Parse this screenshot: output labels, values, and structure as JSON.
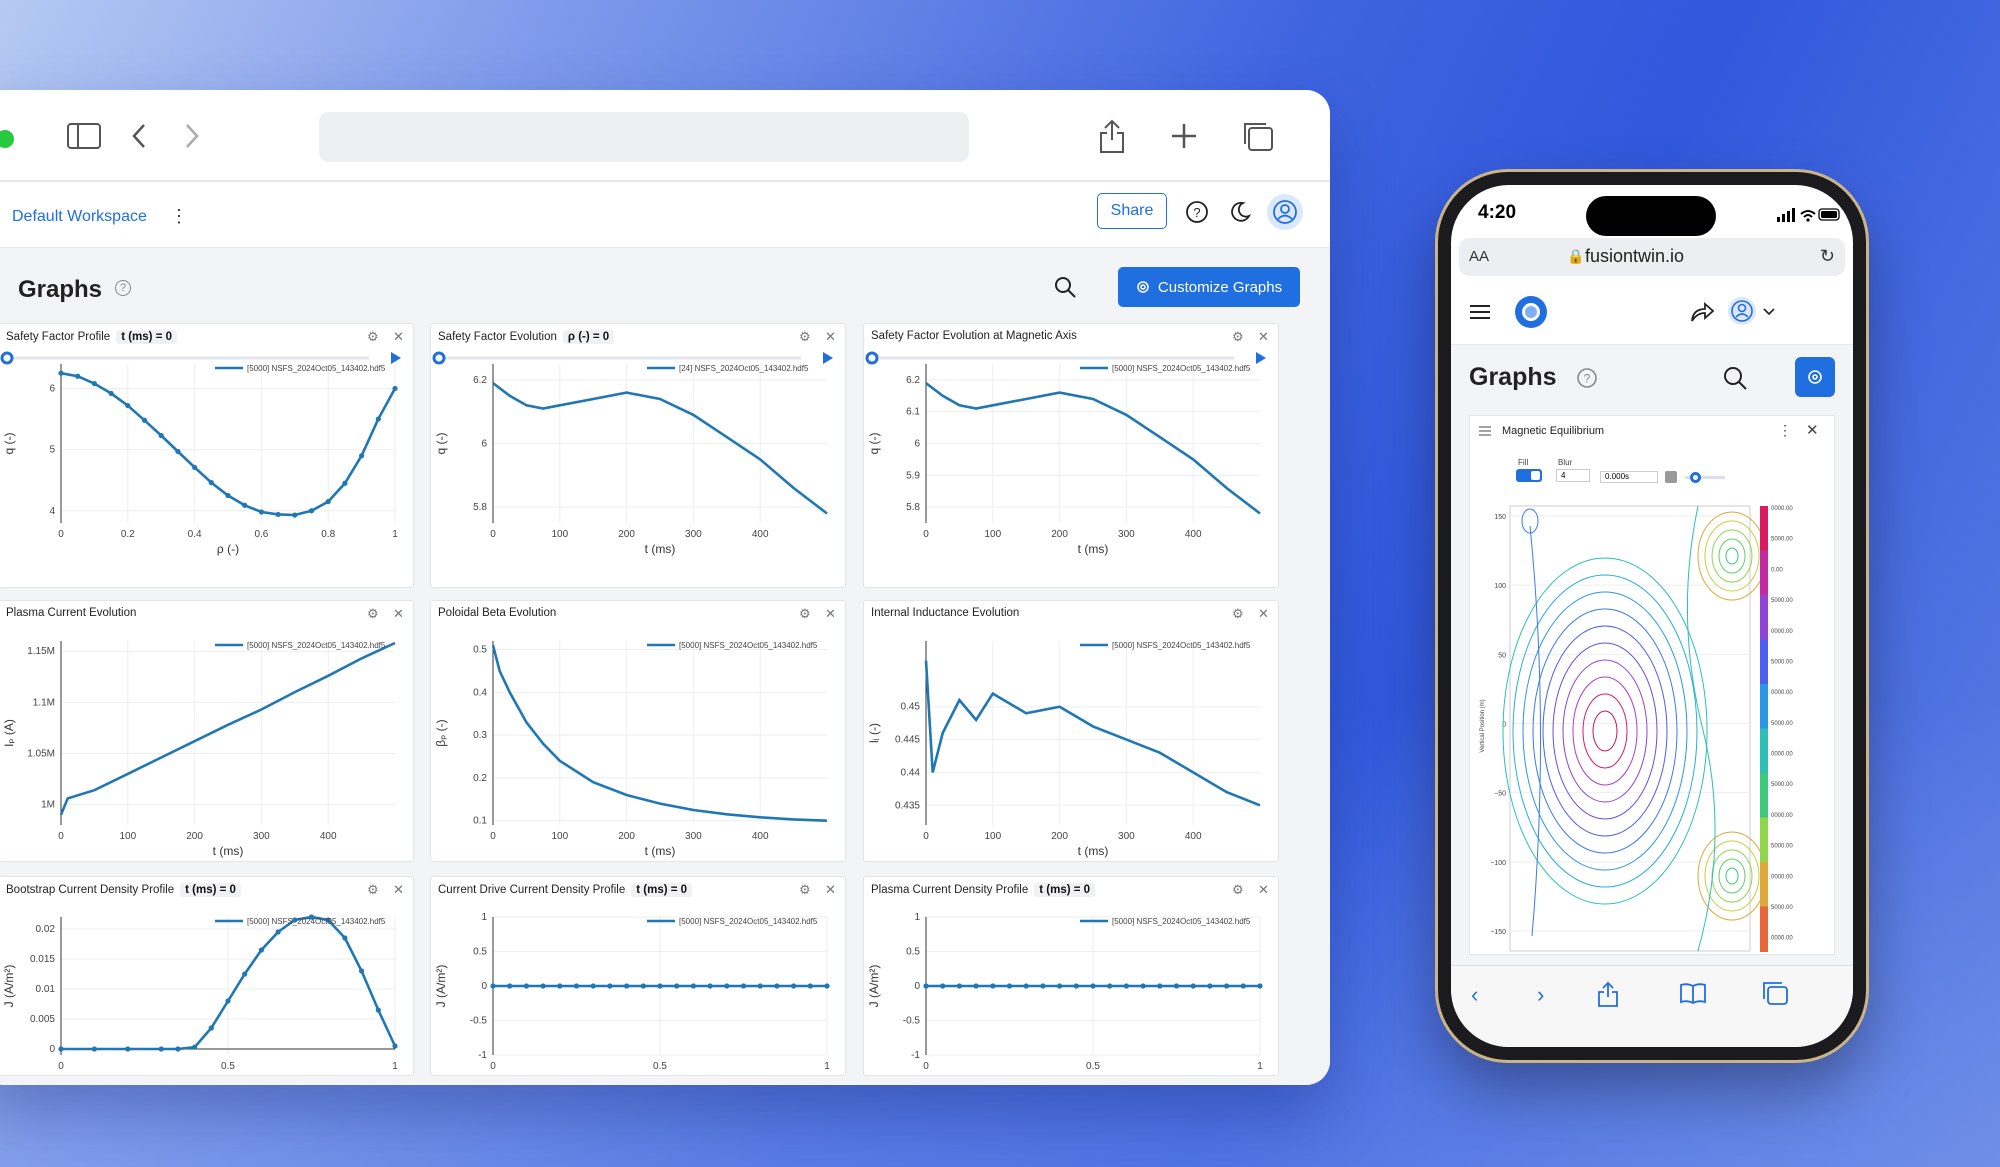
{
  "browser": {
    "dot_color": "#27c93f"
  },
  "app": {
    "workspace": "Default Workspace",
    "share_label": "Share",
    "page_title": "Graphs",
    "customize_label": "Customize Graphs"
  },
  "colors": {
    "accent": "#1f6fe0",
    "series": "#1f77b4"
  },
  "panels": [
    {
      "title": "Safety Factor Profile",
      "badge": "t (ms) = 0"
    },
    {
      "title": "Safety Factor Evolution",
      "badge": "ρ (-) = 0"
    },
    {
      "title": "Safety Factor Evolution at Magnetic Axis",
      "badge": ""
    },
    {
      "title": "Plasma Current Evolution",
      "badge": ""
    },
    {
      "title": "Poloidal Beta Evolution",
      "badge": ""
    },
    {
      "title": "Internal Inductance Evolution",
      "badge": ""
    },
    {
      "title": "Bootstrap Current Density Profile",
      "badge": "t (ms) = 0"
    },
    {
      "title": "Current Drive Current Density Profile",
      "badge": "t (ms) = 0"
    },
    {
      "title": "Plasma Current Density Profile",
      "badge": "t (ms) = 0"
    }
  ],
  "chart_data": [
    {
      "type": "line",
      "series": [
        {
          "name": "[5000] NSFS_2024Oct05_143402.hdf5",
          "x": [
            0,
            0.05,
            0.1,
            0.15,
            0.2,
            0.25,
            0.3,
            0.35,
            0.4,
            0.45,
            0.5,
            0.55,
            0.6,
            0.65,
            0.7,
            0.75,
            0.8,
            0.85,
            0.9,
            0.95,
            1.0
          ],
          "y": [
            6.25,
            6.2,
            6.08,
            5.92,
            5.72,
            5.48,
            5.23,
            4.97,
            4.71,
            4.46,
            4.25,
            4.09,
            3.98,
            3.94,
            3.93,
            4.0,
            4.15,
            4.45,
            4.9,
            5.5,
            6.0
          ]
        }
      ],
      "xlabel": "ρ (-)",
      "ylabel": "q (-)",
      "xlim": [
        0,
        1
      ],
      "ylim": [
        3.8,
        6.4
      ],
      "xticks": [
        "0",
        "0.2",
        "0.4",
        "0.6",
        "0.8",
        "1"
      ],
      "yticks": [
        "4",
        "5",
        "6"
      ]
    },
    {
      "type": "line",
      "series": [
        {
          "name": "[24] NSFS_2024Oct05_143402.hdf5",
          "x": [
            0,
            25,
            50,
            75,
            100,
            150,
            200,
            250,
            300,
            350,
            400,
            450,
            500
          ],
          "y": [
            6.19,
            6.15,
            6.12,
            6.11,
            6.12,
            6.14,
            6.16,
            6.14,
            6.09,
            6.02,
            5.95,
            5.86,
            5.78
          ]
        }
      ],
      "xlabel": "t (ms)",
      "ylabel": "q (-)",
      "xlim": [
        0,
        500
      ],
      "ylim": [
        5.75,
        6.25
      ],
      "xticks": [
        "0",
        "100",
        "200",
        "300",
        "400"
      ],
      "yticks": [
        "5.8",
        "6",
        "6.2"
      ]
    },
    {
      "type": "line",
      "series": [
        {
          "name": "[5000] NSFS_2024Oct05_143402.hdf5",
          "x": [
            0,
            25,
            50,
            75,
            100,
            150,
            200,
            250,
            300,
            350,
            400,
            450,
            500
          ],
          "y": [
            6.19,
            6.15,
            6.12,
            6.11,
            6.12,
            6.14,
            6.16,
            6.14,
            6.09,
            6.02,
            5.95,
            5.86,
            5.78
          ]
        }
      ],
      "xlabel": "t (ms)",
      "ylabel": "q (-)",
      "xlim": [
        0,
        500
      ],
      "ylim": [
        5.75,
        6.25
      ],
      "xticks": [
        "0",
        "100",
        "200",
        "300",
        "400"
      ],
      "yticks": [
        "5.8",
        "5.9",
        "6",
        "6.1",
        "6.2"
      ]
    },
    {
      "type": "line",
      "series": [
        {
          "name": "[5000] NSFS_2024Oct05_143402.hdf5",
          "x": [
            0,
            10,
            50,
            100,
            150,
            200,
            250,
            300,
            350,
            400,
            450,
            500
          ],
          "y": [
            990000,
            1006000,
            1014000,
            1030000,
            1046000,
            1062000,
            1078000,
            1093000,
            1110000,
            1126000,
            1143000,
            1158000
          ]
        }
      ],
      "xlabel": "t (ms)",
      "ylabel": "Iₚ (A)",
      "xlim": [
        0,
        500
      ],
      "ylim": [
        980000,
        1160000
      ],
      "xticks": [
        "0",
        "100",
        "200",
        "300",
        "400"
      ],
      "yticks": [
        "1M",
        "1.05M",
        "1.1M",
        "1.15M"
      ]
    },
    {
      "type": "line",
      "series": [
        {
          "name": "[5000] NSFS_2024Oct05_143402.hdf5",
          "x": [
            0,
            10,
            25,
            50,
            75,
            100,
            150,
            200,
            250,
            300,
            350,
            400,
            450,
            500
          ],
          "y": [
            0.51,
            0.45,
            0.4,
            0.33,
            0.28,
            0.24,
            0.19,
            0.16,
            0.14,
            0.125,
            0.115,
            0.108,
            0.103,
            0.1
          ]
        }
      ],
      "xlabel": "t (ms)",
      "ylabel": "βₚ (-)",
      "xlim": [
        0,
        500
      ],
      "ylim": [
        0.09,
        0.52
      ],
      "xticks": [
        "0",
        "100",
        "200",
        "300",
        "400"
      ],
      "yticks": [
        "0.1",
        "0.2",
        "0.3",
        "0.4",
        "0.5"
      ]
    },
    {
      "type": "line",
      "series": [
        {
          "name": "[5000] NSFS_2024Oct05_143402.hdf5",
          "x": [
            0,
            10,
            25,
            50,
            75,
            100,
            150,
            200,
            250,
            300,
            350,
            400,
            450,
            500
          ],
          "y": [
            0.457,
            0.44,
            0.446,
            0.451,
            0.448,
            0.452,
            0.449,
            0.45,
            0.447,
            0.445,
            0.443,
            0.44,
            0.437,
            0.435
          ]
        }
      ],
      "xlabel": "t (ms)",
      "ylabel": "lᵢ (-)",
      "xlim": [
        0,
        500
      ],
      "ylim": [
        0.432,
        0.46
      ],
      "xticks": [
        "0",
        "100",
        "200",
        "300",
        "400"
      ],
      "yticks": [
        "0.435",
        "0.44",
        "0.445",
        "0.45"
      ]
    },
    {
      "type": "line",
      "series": [
        {
          "name": "[5000] NSFS_2024Oct05_143402.hdf5",
          "x": [
            0,
            0.1,
            0.2,
            0.3,
            0.35,
            0.4,
            0.45,
            0.5,
            0.55,
            0.6,
            0.65,
            0.7,
            0.75,
            0.8,
            0.85,
            0.9,
            0.95,
            1.0
          ],
          "y": [
            0,
            0,
            0,
            0,
            0,
            0.0003,
            0.0035,
            0.008,
            0.0125,
            0.0165,
            0.0195,
            0.0215,
            0.022,
            0.0215,
            0.0185,
            0.013,
            0.0065,
            0.0005
          ]
        }
      ],
      "xlabel": "",
      "ylabel": "J (A/m²)",
      "xlim": [
        0,
        1
      ],
      "ylim": [
        -0.001,
        0.022
      ],
      "xticks": [
        "0",
        "0.5",
        "1"
      ],
      "yticks": [
        "0",
        "0.005",
        "0.01",
        "0.015",
        "0.02"
      ]
    },
    {
      "type": "line",
      "series": [
        {
          "name": "[5000] NSFS_2024Oct05_143402.hdf5",
          "x": [
            0,
            0.05,
            0.1,
            0.15,
            0.2,
            0.25,
            0.3,
            0.35,
            0.4,
            0.45,
            0.5,
            0.55,
            0.6,
            0.65,
            0.7,
            0.75,
            0.8,
            0.85,
            0.9,
            0.95,
            1.0
          ],
          "y": [
            0,
            0,
            0,
            0,
            0,
            0,
            0,
            0,
            0,
            0,
            0,
            0,
            0,
            0,
            0,
            0,
            0,
            0,
            0,
            0,
            0
          ]
        }
      ],
      "xlabel": "",
      "ylabel": "J (A/m²)",
      "xlim": [
        0,
        1
      ],
      "ylim": [
        -1,
        1
      ],
      "xticks": [
        "0",
        "0.5",
        "1"
      ],
      "yticks": [
        "-1",
        "-0.5",
        "0",
        "0.5",
        "1"
      ]
    },
    {
      "type": "line",
      "series": [
        {
          "name": "[5000] NSFS_2024Oct05_143402.hdf5",
          "x": [
            0,
            0.05,
            0.1,
            0.15,
            0.2,
            0.25,
            0.3,
            0.35,
            0.4,
            0.45,
            0.5,
            0.55,
            0.6,
            0.65,
            0.7,
            0.75,
            0.8,
            0.85,
            0.9,
            0.95,
            1.0
          ],
          "y": [
            0,
            0,
            0,
            0,
            0,
            0,
            0,
            0,
            0,
            0,
            0,
            0,
            0,
            0,
            0,
            0,
            0,
            0,
            0,
            0,
            0
          ]
        }
      ],
      "xlabel": "",
      "ylabel": "J (A/m²)",
      "xlim": [
        0,
        1
      ],
      "ylim": [
        -1,
        1
      ],
      "xticks": [
        "0",
        "0.5",
        "1"
      ],
      "yticks": [
        "-1",
        "-0.5",
        "0",
        "0.5",
        "1"
      ]
    }
  ],
  "phone": {
    "time": "4:20",
    "url_aa": "AA",
    "url": "fusiontwin.io",
    "page_title": "Graphs",
    "card_title": "Magnetic Equilibrium",
    "fill_label": "Fill",
    "blur_label": "Blur",
    "blur_value": "4",
    "time_value": "0.000s",
    "yaxis_label": "Vertical Position (m)",
    "yticks": [
      "150",
      "100",
      "50",
      "0",
      "−50",
      "−100",
      "−150"
    ],
    "colorbar_ticks": [
      "0000.00",
      "5000.00",
      "0.00",
      "5000.00",
      "0000.00",
      "5000.00",
      "0000.00",
      "5000.00",
      "0000.00",
      "5000.00",
      "0000.00",
      "5000.00",
      "0000.00",
      "5000.00",
      "0000.00"
    ]
  }
}
